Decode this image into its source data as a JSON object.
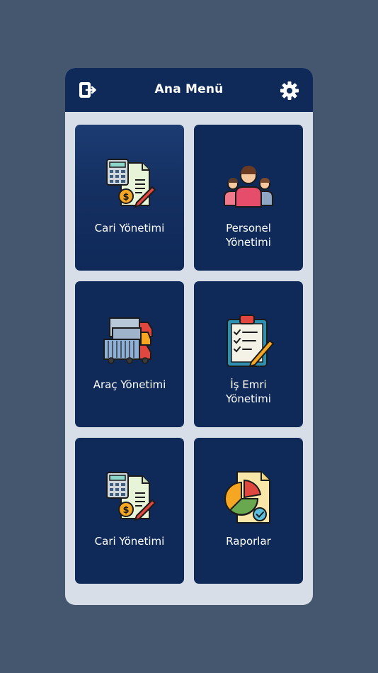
{
  "header": {
    "title": "Ana Menü",
    "left_icon": "logout-icon",
    "right_icon": "gear-icon"
  },
  "colors": {
    "background": "#44576f",
    "panel": "#d8dee8",
    "header": "#0f2a59",
    "tile": "#0f2a59"
  },
  "tiles": [
    {
      "label": "Cari Yönetimi",
      "icon": "accounting-icon"
    },
    {
      "label": "Personel\nYönetimi",
      "icon": "people-icon"
    },
    {
      "label": "Araç Yönetimi",
      "icon": "trucks-icon"
    },
    {
      "label": "İş Emri\nYönetimi",
      "icon": "clipboard-icon"
    },
    {
      "label": "Cari Yönetimi",
      "icon": "accounting-icon"
    },
    {
      "label": "Raporlar",
      "icon": "report-icon"
    }
  ]
}
